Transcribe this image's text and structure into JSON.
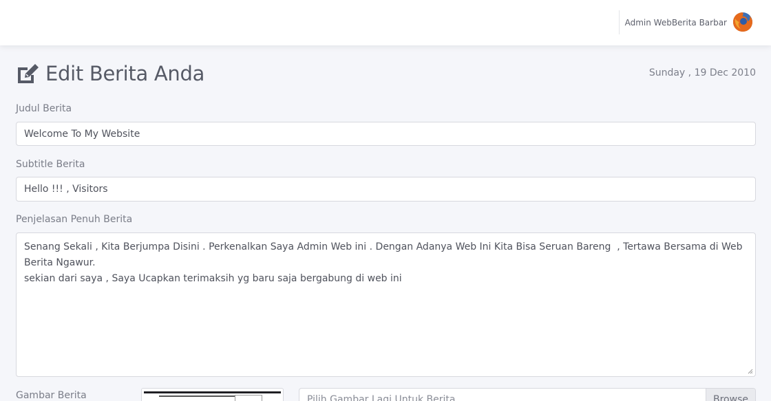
{
  "header": {
    "user_name": "Admin WebBerita Barbar",
    "avatar_icon": "firefox-logo-icon"
  },
  "page": {
    "title": "Edit Berita Anda",
    "title_icon": "edit-icon",
    "date": "Sunday , 19 Dec 2010"
  },
  "form": {
    "judul": {
      "label": "Judul Berita",
      "value": "Welcome To My Website"
    },
    "subtitle": {
      "label": "Subtitle Berita",
      "value": "Hello !!! , Visitors"
    },
    "penjelasan": {
      "label": "Penjelasan Penuh Berita",
      "value": "Senang Sekali , Kita Berjumpa Disini . Perkenalkan Saya Admin Web ini . Dengan Adanya Web Ini Kita Bisa Seruan Bareng  , Tertawa Bersama di Web Berita Ngawur.\nsekian dari saya , Saya Ucapkan terimaksih yg baru saja bergabung di web ini"
    },
    "gambar": {
      "label": "Gambar Berita",
      "file_placeholder": "Pilih Gambar Lagi Untuk Berita",
      "browse_label": "Browse"
    }
  },
  "colors": {
    "background": "#f5f6fa",
    "topbar": "#ffffff",
    "text": "#565a66",
    "border": "#d7d8de"
  }
}
